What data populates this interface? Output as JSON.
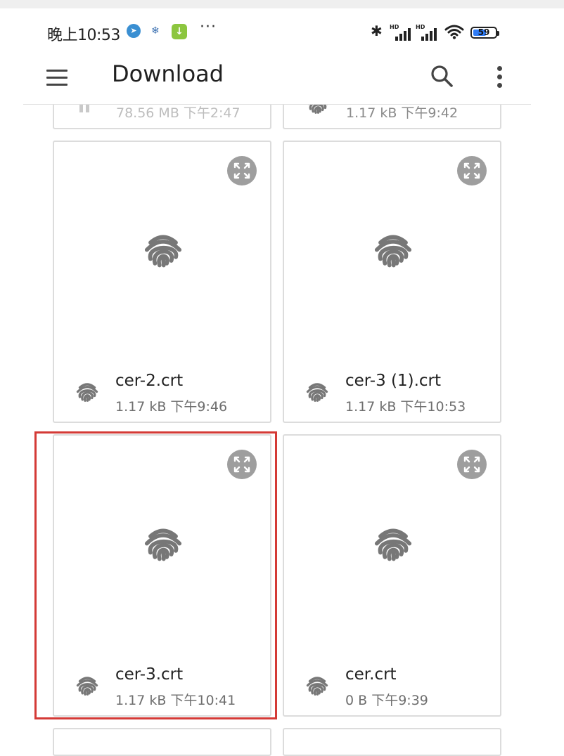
{
  "status_bar": {
    "time": "晚上10:53",
    "more_indicator": "···",
    "signal_label_1": "HD",
    "signal_label_2": "HD",
    "battery": "59"
  },
  "app_bar": {
    "title": "Download",
    "icons": [
      "menu-icon",
      "search-icon",
      "more-vert-icon"
    ]
  },
  "files_partial": [
    {
      "meta": "78.56 MB  下午2:47"
    },
    {
      "meta": "1.17 kB  下午9:42"
    }
  ],
  "files": [
    {
      "name": "cer-2.crt",
      "meta": "1.17 kB  下午9:46"
    },
    {
      "name": "cer-3 (1).crt",
      "meta": "1.17 kB  下午10:53"
    },
    {
      "name": "cer-3.crt",
      "meta": "1.17 kB  下午10:41"
    },
    {
      "name": "cer.crt",
      "meta": "0 B  下午9:39"
    }
  ],
  "colors": {
    "highlight": "#d43a36",
    "icon_grey": "#777777",
    "expand_bg": "#9e9e9e"
  }
}
